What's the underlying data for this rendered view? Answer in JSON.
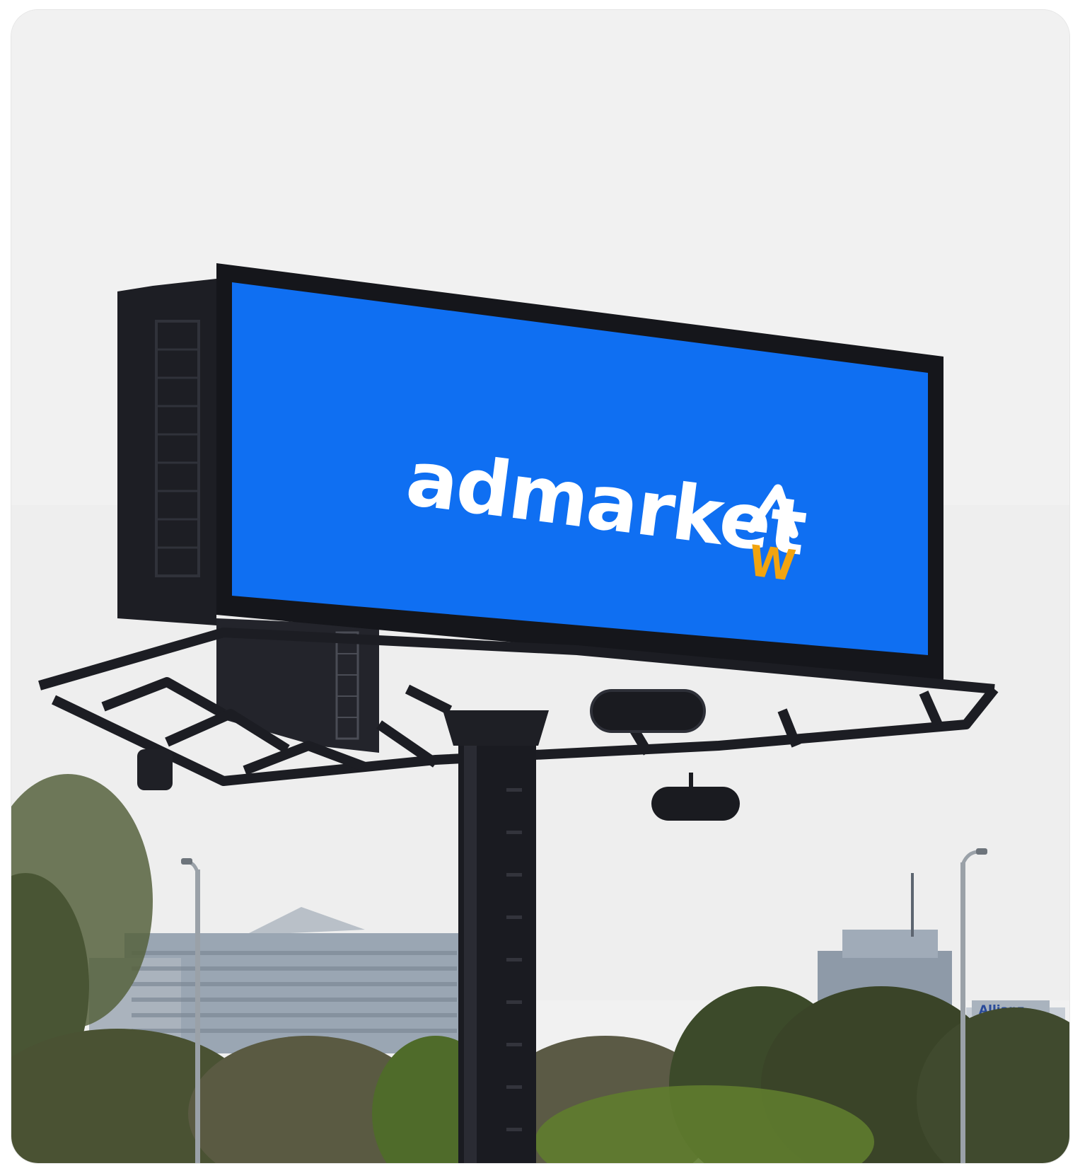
{
  "billboard": {
    "brand_name": "admarket",
    "logo_letter": "W",
    "screen_color": "#0f6ff2",
    "logo_text_color": "#ffffff",
    "logo_accent_color": "#f2a40f",
    "arrow_icon": "up-arrow-icon"
  },
  "background_sign": {
    "text": "Allianz"
  },
  "colors": {
    "sky": "#f1f1f1",
    "structure": "#1b1c22",
    "pole": "#1a1b21",
    "building": "#9aa6b3",
    "trees": "#3f4a2e"
  }
}
